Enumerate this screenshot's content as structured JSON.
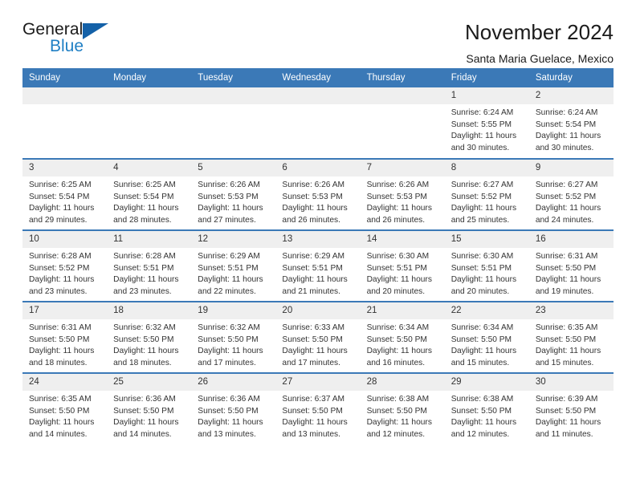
{
  "brand": {
    "name_part1": "General",
    "name_part2": "Blue",
    "triangle_icon": "triangle-icon",
    "accent_color": "#1f7fc4"
  },
  "header": {
    "title": "November 2024",
    "subtitle": "Santa Maria Guelace, Mexico"
  },
  "calendar": {
    "header_color": "#3b79b7",
    "daynum_band_color": "#efefef",
    "weekday_headers": [
      "Sunday",
      "Monday",
      "Tuesday",
      "Wednesday",
      "Thursday",
      "Friday",
      "Saturday"
    ],
    "weeks": [
      [
        {
          "day": "",
          "blank": true
        },
        {
          "day": "",
          "blank": true
        },
        {
          "day": "",
          "blank": true
        },
        {
          "day": "",
          "blank": true
        },
        {
          "day": "",
          "blank": true
        },
        {
          "day": "1",
          "sunrise": "Sunrise: 6:24 AM",
          "sunset": "Sunset: 5:55 PM",
          "daylight": "Daylight: 11 hours and 30 minutes."
        },
        {
          "day": "2",
          "sunrise": "Sunrise: 6:24 AM",
          "sunset": "Sunset: 5:54 PM",
          "daylight": "Daylight: 11 hours and 30 minutes."
        }
      ],
      [
        {
          "day": "3",
          "sunrise": "Sunrise: 6:25 AM",
          "sunset": "Sunset: 5:54 PM",
          "daylight": "Daylight: 11 hours and 29 minutes."
        },
        {
          "day": "4",
          "sunrise": "Sunrise: 6:25 AM",
          "sunset": "Sunset: 5:54 PM",
          "daylight": "Daylight: 11 hours and 28 minutes."
        },
        {
          "day": "5",
          "sunrise": "Sunrise: 6:26 AM",
          "sunset": "Sunset: 5:53 PM",
          "daylight": "Daylight: 11 hours and 27 minutes."
        },
        {
          "day": "6",
          "sunrise": "Sunrise: 6:26 AM",
          "sunset": "Sunset: 5:53 PM",
          "daylight": "Daylight: 11 hours and 26 minutes."
        },
        {
          "day": "7",
          "sunrise": "Sunrise: 6:26 AM",
          "sunset": "Sunset: 5:53 PM",
          "daylight": "Daylight: 11 hours and 26 minutes."
        },
        {
          "day": "8",
          "sunrise": "Sunrise: 6:27 AM",
          "sunset": "Sunset: 5:52 PM",
          "daylight": "Daylight: 11 hours and 25 minutes."
        },
        {
          "day": "9",
          "sunrise": "Sunrise: 6:27 AM",
          "sunset": "Sunset: 5:52 PM",
          "daylight": "Daylight: 11 hours and 24 minutes."
        }
      ],
      [
        {
          "day": "10",
          "sunrise": "Sunrise: 6:28 AM",
          "sunset": "Sunset: 5:52 PM",
          "daylight": "Daylight: 11 hours and 23 minutes."
        },
        {
          "day": "11",
          "sunrise": "Sunrise: 6:28 AM",
          "sunset": "Sunset: 5:51 PM",
          "daylight": "Daylight: 11 hours and 23 minutes."
        },
        {
          "day": "12",
          "sunrise": "Sunrise: 6:29 AM",
          "sunset": "Sunset: 5:51 PM",
          "daylight": "Daylight: 11 hours and 22 minutes."
        },
        {
          "day": "13",
          "sunrise": "Sunrise: 6:29 AM",
          "sunset": "Sunset: 5:51 PM",
          "daylight": "Daylight: 11 hours and 21 minutes."
        },
        {
          "day": "14",
          "sunrise": "Sunrise: 6:30 AM",
          "sunset": "Sunset: 5:51 PM",
          "daylight": "Daylight: 11 hours and 20 minutes."
        },
        {
          "day": "15",
          "sunrise": "Sunrise: 6:30 AM",
          "sunset": "Sunset: 5:51 PM",
          "daylight": "Daylight: 11 hours and 20 minutes."
        },
        {
          "day": "16",
          "sunrise": "Sunrise: 6:31 AM",
          "sunset": "Sunset: 5:50 PM",
          "daylight": "Daylight: 11 hours and 19 minutes."
        }
      ],
      [
        {
          "day": "17",
          "sunrise": "Sunrise: 6:31 AM",
          "sunset": "Sunset: 5:50 PM",
          "daylight": "Daylight: 11 hours and 18 minutes."
        },
        {
          "day": "18",
          "sunrise": "Sunrise: 6:32 AM",
          "sunset": "Sunset: 5:50 PM",
          "daylight": "Daylight: 11 hours and 18 minutes."
        },
        {
          "day": "19",
          "sunrise": "Sunrise: 6:32 AM",
          "sunset": "Sunset: 5:50 PM",
          "daylight": "Daylight: 11 hours and 17 minutes."
        },
        {
          "day": "20",
          "sunrise": "Sunrise: 6:33 AM",
          "sunset": "Sunset: 5:50 PM",
          "daylight": "Daylight: 11 hours and 17 minutes."
        },
        {
          "day": "21",
          "sunrise": "Sunrise: 6:34 AM",
          "sunset": "Sunset: 5:50 PM",
          "daylight": "Daylight: 11 hours and 16 minutes."
        },
        {
          "day": "22",
          "sunrise": "Sunrise: 6:34 AM",
          "sunset": "Sunset: 5:50 PM",
          "daylight": "Daylight: 11 hours and 15 minutes."
        },
        {
          "day": "23",
          "sunrise": "Sunrise: 6:35 AM",
          "sunset": "Sunset: 5:50 PM",
          "daylight": "Daylight: 11 hours and 15 minutes."
        }
      ],
      [
        {
          "day": "24",
          "sunrise": "Sunrise: 6:35 AM",
          "sunset": "Sunset: 5:50 PM",
          "daylight": "Daylight: 11 hours and 14 minutes."
        },
        {
          "day": "25",
          "sunrise": "Sunrise: 6:36 AM",
          "sunset": "Sunset: 5:50 PM",
          "daylight": "Daylight: 11 hours and 14 minutes."
        },
        {
          "day": "26",
          "sunrise": "Sunrise: 6:36 AM",
          "sunset": "Sunset: 5:50 PM",
          "daylight": "Daylight: 11 hours and 13 minutes."
        },
        {
          "day": "27",
          "sunrise": "Sunrise: 6:37 AM",
          "sunset": "Sunset: 5:50 PM",
          "daylight": "Daylight: 11 hours and 13 minutes."
        },
        {
          "day": "28",
          "sunrise": "Sunrise: 6:38 AM",
          "sunset": "Sunset: 5:50 PM",
          "daylight": "Daylight: 11 hours and 12 minutes."
        },
        {
          "day": "29",
          "sunrise": "Sunrise: 6:38 AM",
          "sunset": "Sunset: 5:50 PM",
          "daylight": "Daylight: 11 hours and 12 minutes."
        },
        {
          "day": "30",
          "sunrise": "Sunrise: 6:39 AM",
          "sunset": "Sunset: 5:50 PM",
          "daylight": "Daylight: 11 hours and 11 minutes."
        }
      ]
    ]
  }
}
